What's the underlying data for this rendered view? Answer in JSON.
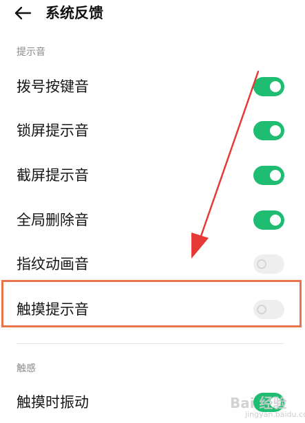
{
  "header": {
    "back_icon": "back-arrow-icon",
    "title": "系统反馈"
  },
  "sections": [
    {
      "label": "提示音",
      "items": [
        {
          "label": "拨号按键音",
          "enabled": true
        },
        {
          "label": "锁屏提示音",
          "enabled": true
        },
        {
          "label": "截屏提示音",
          "enabled": true
        },
        {
          "label": "全局删除音",
          "enabled": true
        },
        {
          "label": "指纹动画音",
          "enabled": false
        },
        {
          "label": "触摸提示音",
          "enabled": false
        }
      ]
    },
    {
      "label": "触感",
      "items": [
        {
          "label": "触摸时振动",
          "enabled": true
        }
      ]
    }
  ],
  "colors": {
    "toggle_on": "#1fbd71",
    "toggle_off": "#eeeeee",
    "annotation_arrow": "#e53935",
    "annotation_box": "#e8744a"
  },
  "watermark": {
    "brand": "Bai 经验",
    "sub": "jingyan.baidu.com"
  }
}
